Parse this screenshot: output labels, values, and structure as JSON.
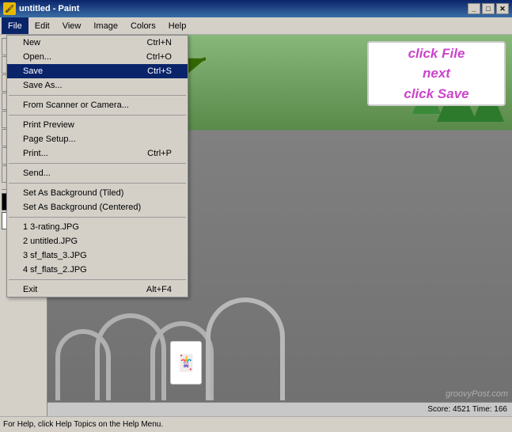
{
  "titleBar": {
    "title": "untitled - Paint",
    "icon": "🖌",
    "buttons": [
      "_",
      "□",
      "✕"
    ]
  },
  "menuBar": {
    "items": [
      "File",
      "Edit",
      "View",
      "Image",
      "Colors",
      "Help"
    ]
  },
  "fileMenu": {
    "items": [
      {
        "label": "New",
        "shortcut": "Ctrl+N",
        "type": "item"
      },
      {
        "label": "Open...",
        "shortcut": "Ctrl+O",
        "type": "item"
      },
      {
        "label": "Save",
        "shortcut": "Ctrl+S",
        "type": "item",
        "selected": true
      },
      {
        "label": "Save As...",
        "shortcut": "",
        "type": "item"
      },
      {
        "type": "separator"
      },
      {
        "label": "From Scanner or Camera...",
        "shortcut": "",
        "type": "item"
      },
      {
        "type": "separator"
      },
      {
        "label": "Print Preview",
        "shortcut": "",
        "type": "item"
      },
      {
        "label": "Page Setup...",
        "shortcut": "",
        "type": "item"
      },
      {
        "label": "Print...",
        "shortcut": "Ctrl+P",
        "type": "item"
      },
      {
        "type": "separator"
      },
      {
        "label": "Send...",
        "shortcut": "",
        "type": "item"
      },
      {
        "type": "separator"
      },
      {
        "label": "Set As Background (Tiled)",
        "shortcut": "",
        "type": "item"
      },
      {
        "label": "Set As Background (Centered)",
        "shortcut": "",
        "type": "item"
      },
      {
        "type": "separator"
      },
      {
        "label": "1 3-rating.JPG",
        "shortcut": "",
        "type": "item"
      },
      {
        "label": "2 untitled.JPG",
        "shortcut": "",
        "type": "item"
      },
      {
        "label": "3 sf_flats_3.JPG",
        "shortcut": "",
        "type": "item"
      },
      {
        "label": "4 sf_flats_2.JPG",
        "shortcut": "",
        "type": "item"
      },
      {
        "type": "separator"
      },
      {
        "label": "Exit",
        "shortcut": "Alt+F4",
        "type": "item"
      }
    ]
  },
  "annotation": {
    "line1": "click File",
    "line2": "next",
    "line3": "click Save"
  },
  "scoreBar": {
    "text": "Score: 4521  Time: 166"
  },
  "watermark": "groovyPost.com"
}
